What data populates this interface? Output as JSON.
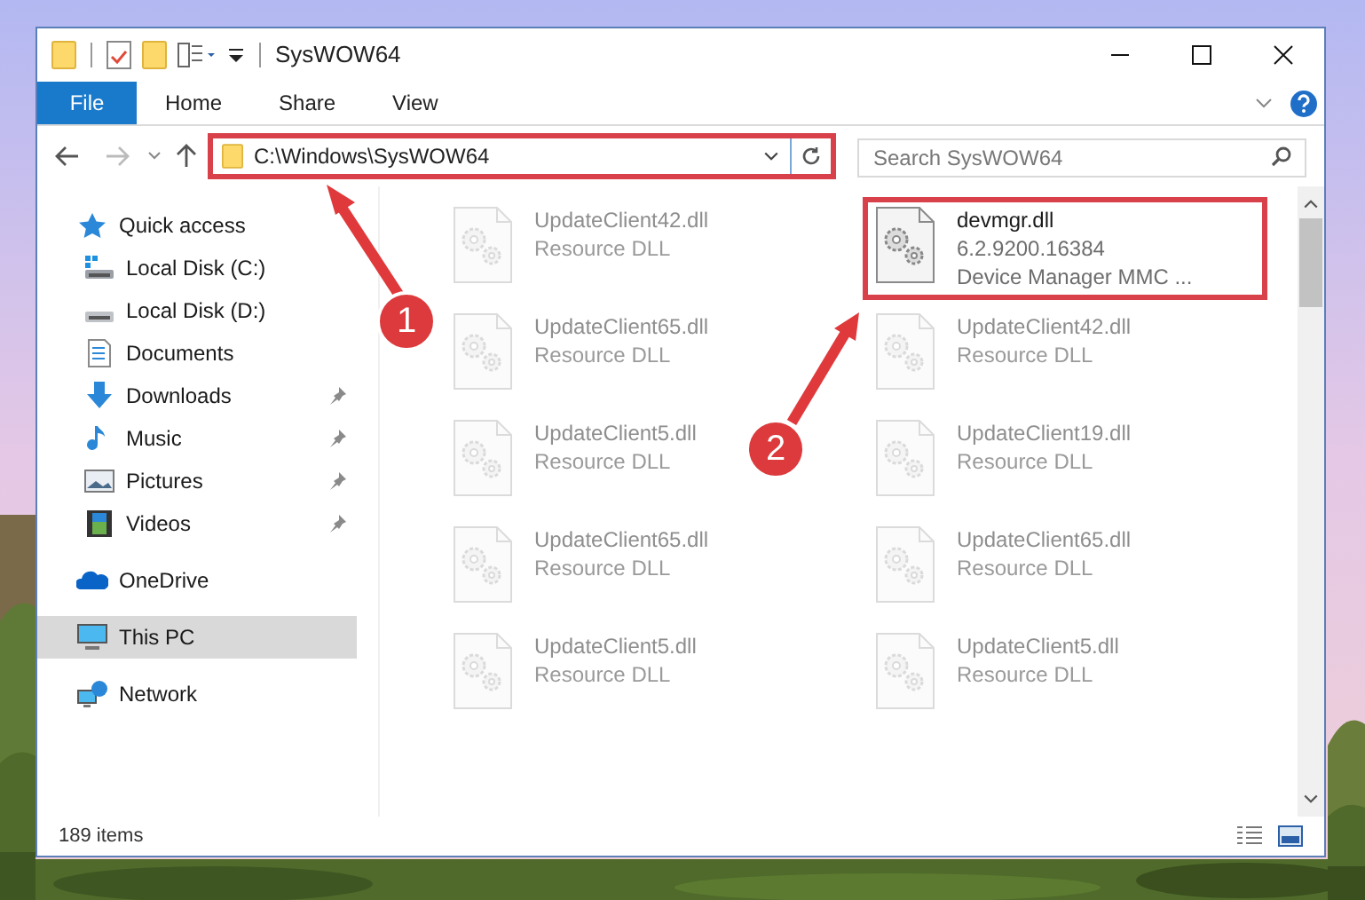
{
  "window": {
    "title": "SysWOW64"
  },
  "ribbon_tabs": [
    {
      "label": "File",
      "kind": "file"
    },
    {
      "label": "Home",
      "kind": "tab"
    },
    {
      "label": "Share",
      "kind": "tab"
    },
    {
      "label": "View",
      "kind": "tab"
    }
  ],
  "address_bar": {
    "path": "C:\\Windows\\SysWOW64",
    "highlighted": true
  },
  "search": {
    "placeholder": "Search SysWOW64"
  },
  "sidebar": {
    "items": [
      {
        "label": "Quick access",
        "kind": "star",
        "pinned": false,
        "selected": false,
        "gap": false,
        "indent": false
      },
      {
        "label": "Local Disk (C:)",
        "kind": "disk-c",
        "pinned": false,
        "selected": false,
        "gap": false,
        "indent": true
      },
      {
        "label": "Local Disk (D:)",
        "kind": "disk",
        "pinned": false,
        "selected": false,
        "gap": false,
        "indent": true
      },
      {
        "label": "Documents",
        "kind": "documents",
        "pinned": false,
        "selected": false,
        "gap": false,
        "indent": true
      },
      {
        "label": "Downloads",
        "kind": "downloads",
        "pinned": true,
        "selected": false,
        "gap": false,
        "indent": true
      },
      {
        "label": "Music",
        "kind": "music",
        "pinned": true,
        "selected": false,
        "gap": false,
        "indent": true
      },
      {
        "label": "Pictures",
        "kind": "pictures",
        "pinned": true,
        "selected": false,
        "gap": false,
        "indent": true
      },
      {
        "label": "Videos",
        "kind": "videos",
        "pinned": true,
        "selected": false,
        "gap": false,
        "indent": true
      },
      {
        "label": "OneDrive",
        "kind": "cloud",
        "pinned": false,
        "selected": false,
        "gap": true,
        "indent": false
      },
      {
        "label": "This PC",
        "kind": "pc",
        "pinned": false,
        "selected": true,
        "gap": true,
        "indent": false
      },
      {
        "label": "Network",
        "kind": "network",
        "pinned": false,
        "selected": false,
        "gap": true,
        "indent": false
      }
    ]
  },
  "file_columns": [
    [
      {
        "lines": [
          "UpdateClient42.dll",
          "Resource DLL"
        ],
        "faded": true,
        "highlighted": false
      },
      {
        "lines": [
          "UpdateClient65.dll",
          "Resource DLL"
        ],
        "faded": true,
        "highlighted": false
      },
      {
        "lines": [
          "UpdateClient5.dll",
          "Resource DLL"
        ],
        "faded": true,
        "highlighted": false
      },
      {
        "lines": [
          "UpdateClient65.dll",
          "Resource DLL"
        ],
        "faded": true,
        "highlighted": false
      },
      {
        "lines": [
          "UpdateClient5.dll",
          "Resource DLL"
        ],
        "faded": true,
        "highlighted": false
      }
    ],
    [
      {
        "lines": [
          "devmgr.dll",
          "6.2.9200.16384",
          "Device Manager MMC ..."
        ],
        "faded": false,
        "highlighted": true
      },
      {
        "lines": [
          "UpdateClient42.dll",
          "Resource DLL"
        ],
        "faded": true,
        "highlighted": false
      },
      {
        "lines": [
          "UpdateClient19.dll",
          "Resource DLL"
        ],
        "faded": true,
        "highlighted": false
      },
      {
        "lines": [
          "UpdateClient65.dll",
          "Resource DLL"
        ],
        "faded": true,
        "highlighted": false
      },
      {
        "lines": [
          "UpdateClient5.dll",
          "Resource DLL"
        ],
        "faded": true,
        "highlighted": false
      }
    ]
  ],
  "status_bar": {
    "item_count": "189 items"
  },
  "annotations": [
    {
      "number": "1"
    },
    {
      "number": "2"
    }
  ]
}
